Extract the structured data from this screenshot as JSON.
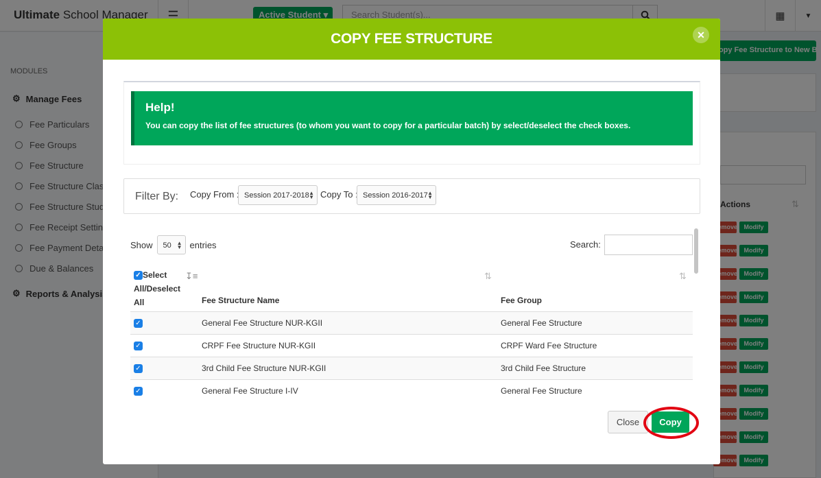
{
  "app": {
    "brand_bold": "Ultimate",
    "brand_rest": "School Manager",
    "active_student_label": "Active Student",
    "search_placeholder": "Search Student(s)...",
    "copy_batch_label": "Copy Fee Structure to New Batch",
    "actions_header": "Actions",
    "remove_label": "Remove",
    "modify_label": "Modify"
  },
  "sidebar": {
    "modules_label": "MODULES",
    "manage_fees": "Manage Fees",
    "items": [
      {
        "label": "Fee Particulars"
      },
      {
        "label": "Fee Groups"
      },
      {
        "label": "Fee Structure"
      },
      {
        "label": "Fee Structure Class"
      },
      {
        "label": "Fee Structure Student"
      },
      {
        "label": "Fee Receipt Setting"
      },
      {
        "label": "Fee Payment Details"
      },
      {
        "label": "Due & Balances"
      }
    ],
    "reports": "Reports & Analysis"
  },
  "modal": {
    "title": "COPY FEE STRUCTURE",
    "help_title": "Help!",
    "help_text": "You can copy the list of fee structures (to whom you want to copy for a particular batch) by select/deselect the check boxes.",
    "filter_by": "Filter By:",
    "copy_from_label": "Copy From :",
    "copy_from_value": "Session 2017-2018",
    "copy_to_label": "Copy To :",
    "copy_to_value": "Session 2016-2017",
    "show_label": "Show",
    "entries_value": "50",
    "entries_label": "entries",
    "search_label": "Search:",
    "select_all_line1": "Select",
    "select_all_line2": "All/Deselect",
    "select_all_line3": "All",
    "col_name": "Fee Structure Name",
    "col_group": "Fee Group",
    "rows": [
      {
        "name": "General Fee Structure NUR-KGII",
        "group": "General Fee Structure"
      },
      {
        "name": "CRPF Fee Structure NUR-KGII",
        "group": "CRPF Ward Fee Structure"
      },
      {
        "name": "3rd Child Fee Structure NUR-KGII",
        "group": "3rd Child Fee Structure"
      },
      {
        "name": "General Fee Structure I-IV",
        "group": "General Fee Structure"
      }
    ],
    "close_label": "Close",
    "copy_label": "Copy"
  },
  "colors": {
    "header_green": "#8cc106",
    "success_green": "#00a65a",
    "highlight_red": "#e20613",
    "checkbox_blue": "#1a7fe6"
  }
}
